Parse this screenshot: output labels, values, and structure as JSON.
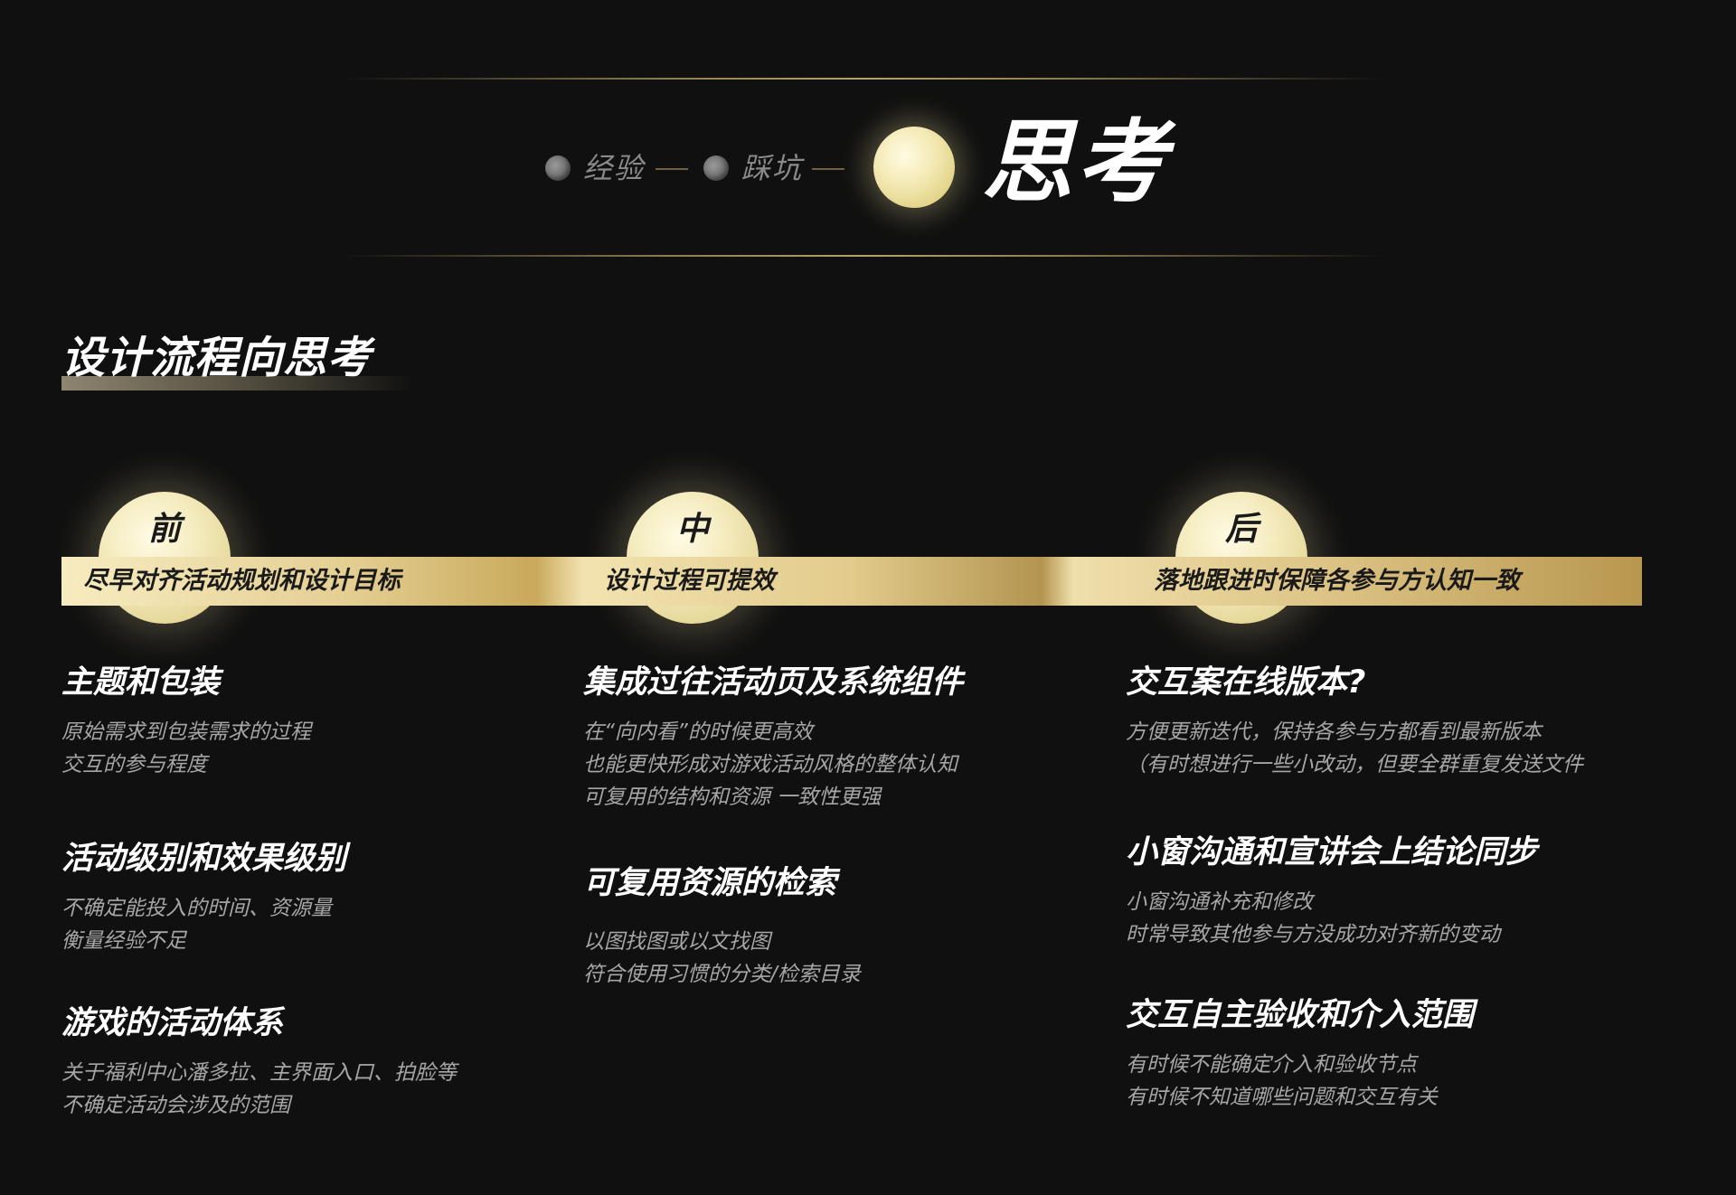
{
  "header": {
    "nav": [
      {
        "label": "经验"
      },
      {
        "label": "踩坑"
      }
    ],
    "title": "思考"
  },
  "section": {
    "title": "设计流程向思考"
  },
  "phases": [
    {
      "char": "前",
      "label": "尽早对齐活动规划和设计目标"
    },
    {
      "char": "中",
      "label": "设计过程可提效"
    },
    {
      "char": "后",
      "label": "落地跟进时保障各参与方认知一致"
    }
  ],
  "columns": [
    {
      "items": [
        {
          "title": "主题和包装",
          "lines": [
            "原始需求到包装需求的过程",
            "交互的参与程度"
          ]
        },
        {
          "title": "活动级别和效果级别",
          "lines": [
            "不确定能投入的时间、资源量",
            "衡量经验不足"
          ]
        },
        {
          "title": "游戏的活动体系",
          "lines": [
            "关于福利中心潘多拉、主界面入口、拍脸等",
            "不确定活动会涉及的范围"
          ]
        }
      ]
    },
    {
      "items": [
        {
          "title": "集成过往活动页及系统组件",
          "lines": [
            "在“向内看”的时候更高效",
            "也能更快形成对游戏活动风格的整体认知",
            "可复用的结构和资源 一致性更强"
          ]
        },
        {
          "title": "可复用资源的检索",
          "lines": [
            "以图找图或以文找图",
            "符合使用习惯的分类/检索目录"
          ]
        }
      ]
    },
    {
      "items": [
        {
          "title": "交互案在线版本?",
          "lines": [
            "方便更新迭代，保持各参与方都看到最新版本",
            "（有时想进行一些小改动，但要全群重复发送文件"
          ]
        },
        {
          "title": "小窗沟通和宣讲会上结论同步",
          "lines": [
            "小窗沟通补充和修改",
            "时常导致其他参与方没成功对齐新的变动"
          ]
        },
        {
          "title": "交互自主验收和介入范围",
          "lines": [
            "有时候不能确定介入和验收节点",
            "有时候不知道哪些问题和交互有关"
          ]
        }
      ]
    }
  ]
}
